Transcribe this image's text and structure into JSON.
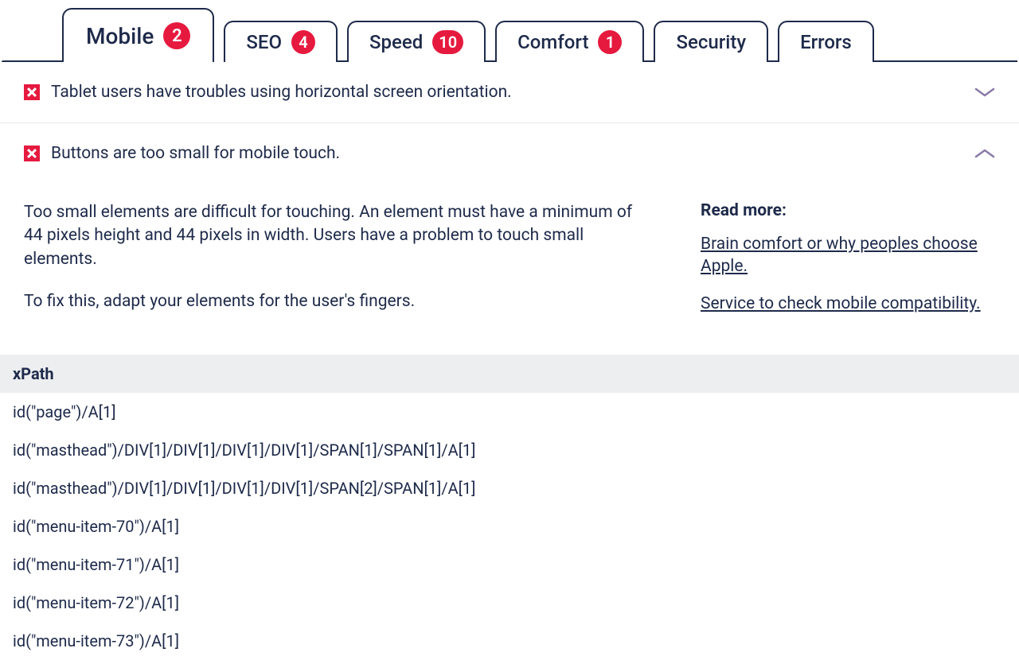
{
  "tabs": [
    {
      "label": "Mobile",
      "count": "2",
      "active": true
    },
    {
      "label": "SEO",
      "count": "4",
      "active": false
    },
    {
      "label": "Speed",
      "count": "10",
      "active": false
    },
    {
      "label": "Comfort",
      "count": "1",
      "active": false
    },
    {
      "label": "Security",
      "count": null,
      "active": false
    },
    {
      "label": "Errors",
      "count": null,
      "active": false
    }
  ],
  "issues": [
    {
      "title": "Tablet users have troubles using horizontal screen orientation.",
      "expanded": false
    },
    {
      "title": "Buttons are too small for mobile touch.",
      "expanded": true,
      "desc1": "Too small elements are difficult for touching. An element must have a minimum of 44 pixels height and 44 pixels in width. Users have a problem to touch small elements.",
      "desc2": "To fix this, adapt your elements for the user's fingers.",
      "readmore_title": "Read more:",
      "links": [
        "Brain comfort or why peoples choose Apple.",
        "Service to check mobile compatibility."
      ]
    }
  ],
  "xpath": {
    "header": "xPath",
    "rows": [
      "id(\"page\")/A[1]",
      "id(\"masthead\")/DIV[1]/DIV[1]/DIV[1]/DIV[1]/SPAN[1]/SPAN[1]/A[1]",
      "id(\"masthead\")/DIV[1]/DIV[1]/DIV[1]/DIV[1]/SPAN[2]/SPAN[1]/A[1]",
      "id(\"menu-item-70\")/A[1]",
      "id(\"menu-item-71\")/A[1]",
      "id(\"menu-item-72\")/A[1]",
      "id(\"menu-item-73\")/A[1]"
    ]
  }
}
